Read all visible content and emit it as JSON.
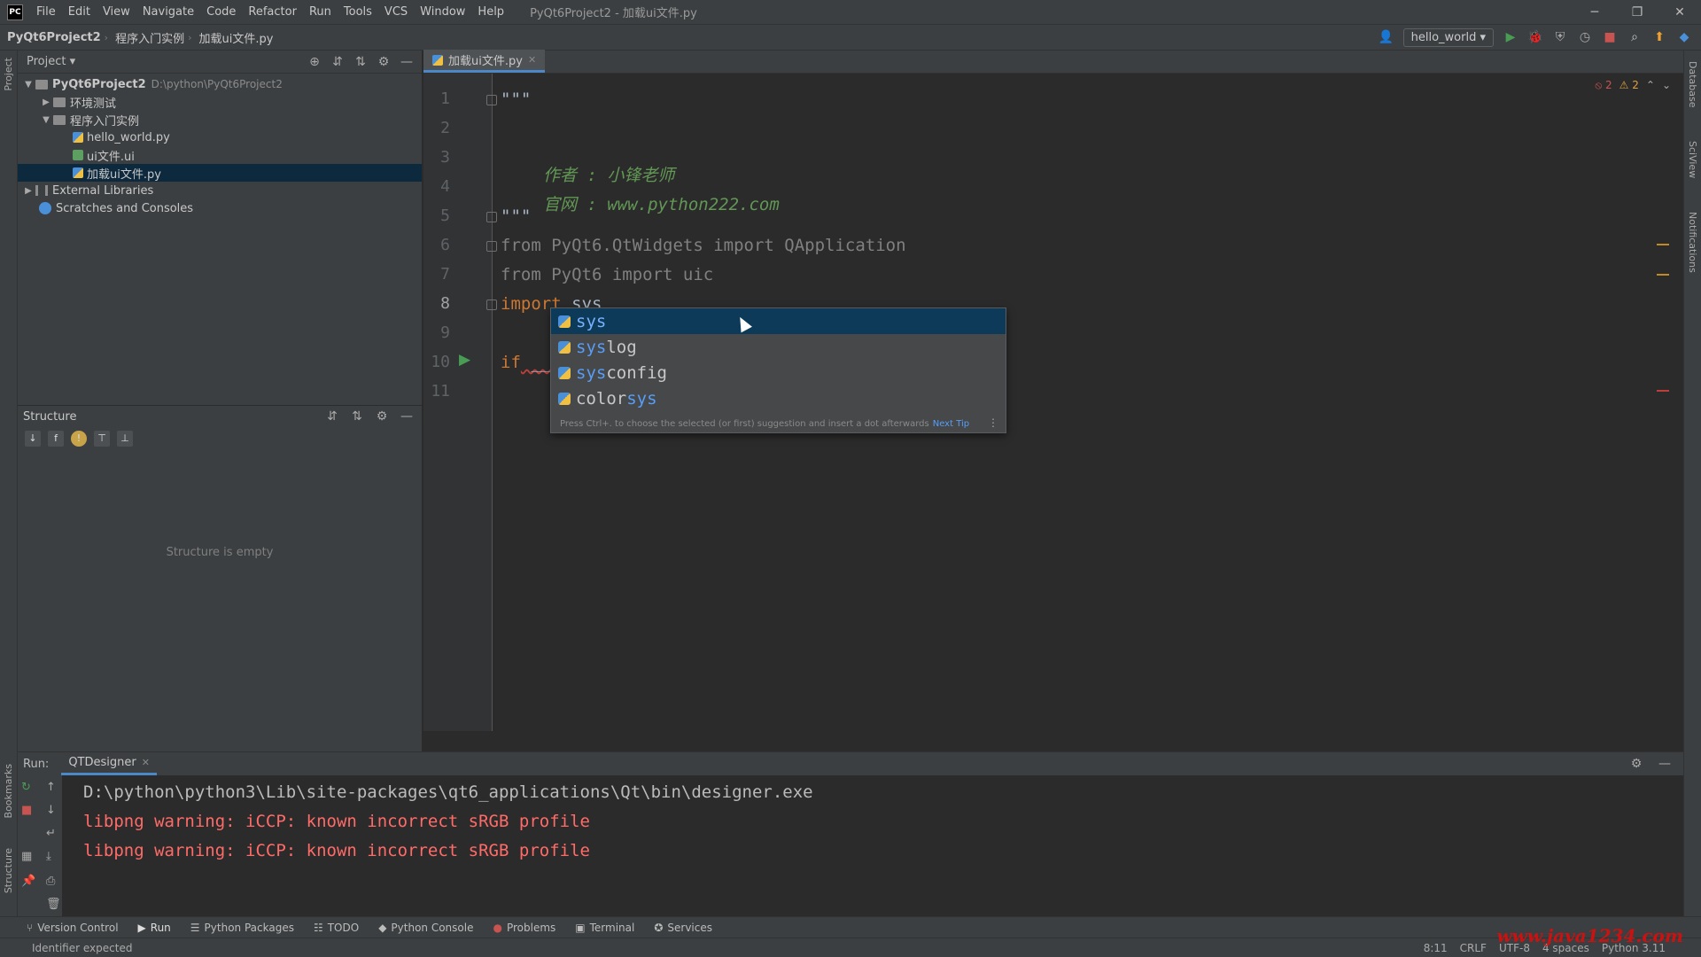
{
  "titlebar": {
    "logo": "PC",
    "menu": [
      "File",
      "Edit",
      "View",
      "Navigate",
      "Code",
      "Refactor",
      "Run",
      "Tools",
      "VCS",
      "Window",
      "Help"
    ],
    "title": "PyQt6Project2 - 加载ui文件.py"
  },
  "navbar": {
    "crumbs": [
      "PyQt6Project2",
      "程序入门实例",
      "加载ui文件.py"
    ],
    "run_config": "hello_world"
  },
  "left_stripe": {
    "project_label": "Project",
    "bookmarks_label": "Bookmarks",
    "structure_label": "Structure"
  },
  "right_stripe": {
    "database_label": "Database",
    "sciview_label": "SciView",
    "notifications_label": "Notifications"
  },
  "project": {
    "title": "Project",
    "tree": [
      {
        "label": "PyQt6Project2",
        "hint": "D:\\python\\PyQt6Project2"
      },
      {
        "label": "环境测试"
      },
      {
        "label": "程序入门实例"
      },
      {
        "label": "hello_world.py"
      },
      {
        "label": "ui文件.ui"
      },
      {
        "label": "加载ui文件.py"
      },
      {
        "label": "External Libraries"
      },
      {
        "label": "Scratches and Consoles"
      }
    ]
  },
  "structure": {
    "title": "Structure",
    "empty_text": "Structure is empty"
  },
  "editor": {
    "tab_label": "加载ui文件.py",
    "inspections": {
      "errors": "2",
      "warnings": "2"
    },
    "line_numbers": [
      "1",
      "2",
      "3",
      "4",
      "5",
      "6",
      "7",
      "8",
      "9",
      "10",
      "11"
    ],
    "lines": {
      "l1": "\"\"\"",
      "l3": "作者 : 小锋老师",
      "l4": "官网 : www.python222.com",
      "l5": "\"\"\"",
      "l6": "from PyQt6.QtWidgets import QApplication",
      "l7": "from PyQt6 import uic",
      "l8_kw": "import",
      "l8_rest": " sys",
      "l10_kw": "if",
      "l10_rest": " __"
    }
  },
  "completion": {
    "items": [
      {
        "match": "sys",
        "rest": ""
      },
      {
        "match": "sys",
        "rest": "log"
      },
      {
        "match": "sys",
        "rest": "config"
      },
      {
        "prefix": "color",
        "match": "sys"
      }
    ],
    "hint": "Press Ctrl+. to choose the selected (or first) suggestion and insert a dot afterwards",
    "next_tip": "Next Tip"
  },
  "run": {
    "label": "Run:",
    "tab": "QTDesigner",
    "output": [
      {
        "text": "D:\\python\\python3\\Lib\\site-packages\\qt6_applications\\Qt\\bin\\designer.exe",
        "kind": "out"
      },
      {
        "text": "libpng warning: iCCP: known incorrect sRGB profile",
        "kind": "err"
      },
      {
        "text": "libpng warning: iCCP: known incorrect sRGB profile",
        "kind": "err"
      }
    ]
  },
  "tooltabs": [
    "Version Control",
    "Run",
    "Python Packages",
    "TODO",
    "Python Console",
    "Problems",
    "Terminal",
    "Services"
  ],
  "status": {
    "message": "Identifier expected",
    "position": "8:11",
    "line_sep": "CRLF",
    "encoding": "UTF-8",
    "indent": "4 spaces",
    "interpreter": "Python 3.11"
  },
  "watermark": "www.java1234.com"
}
